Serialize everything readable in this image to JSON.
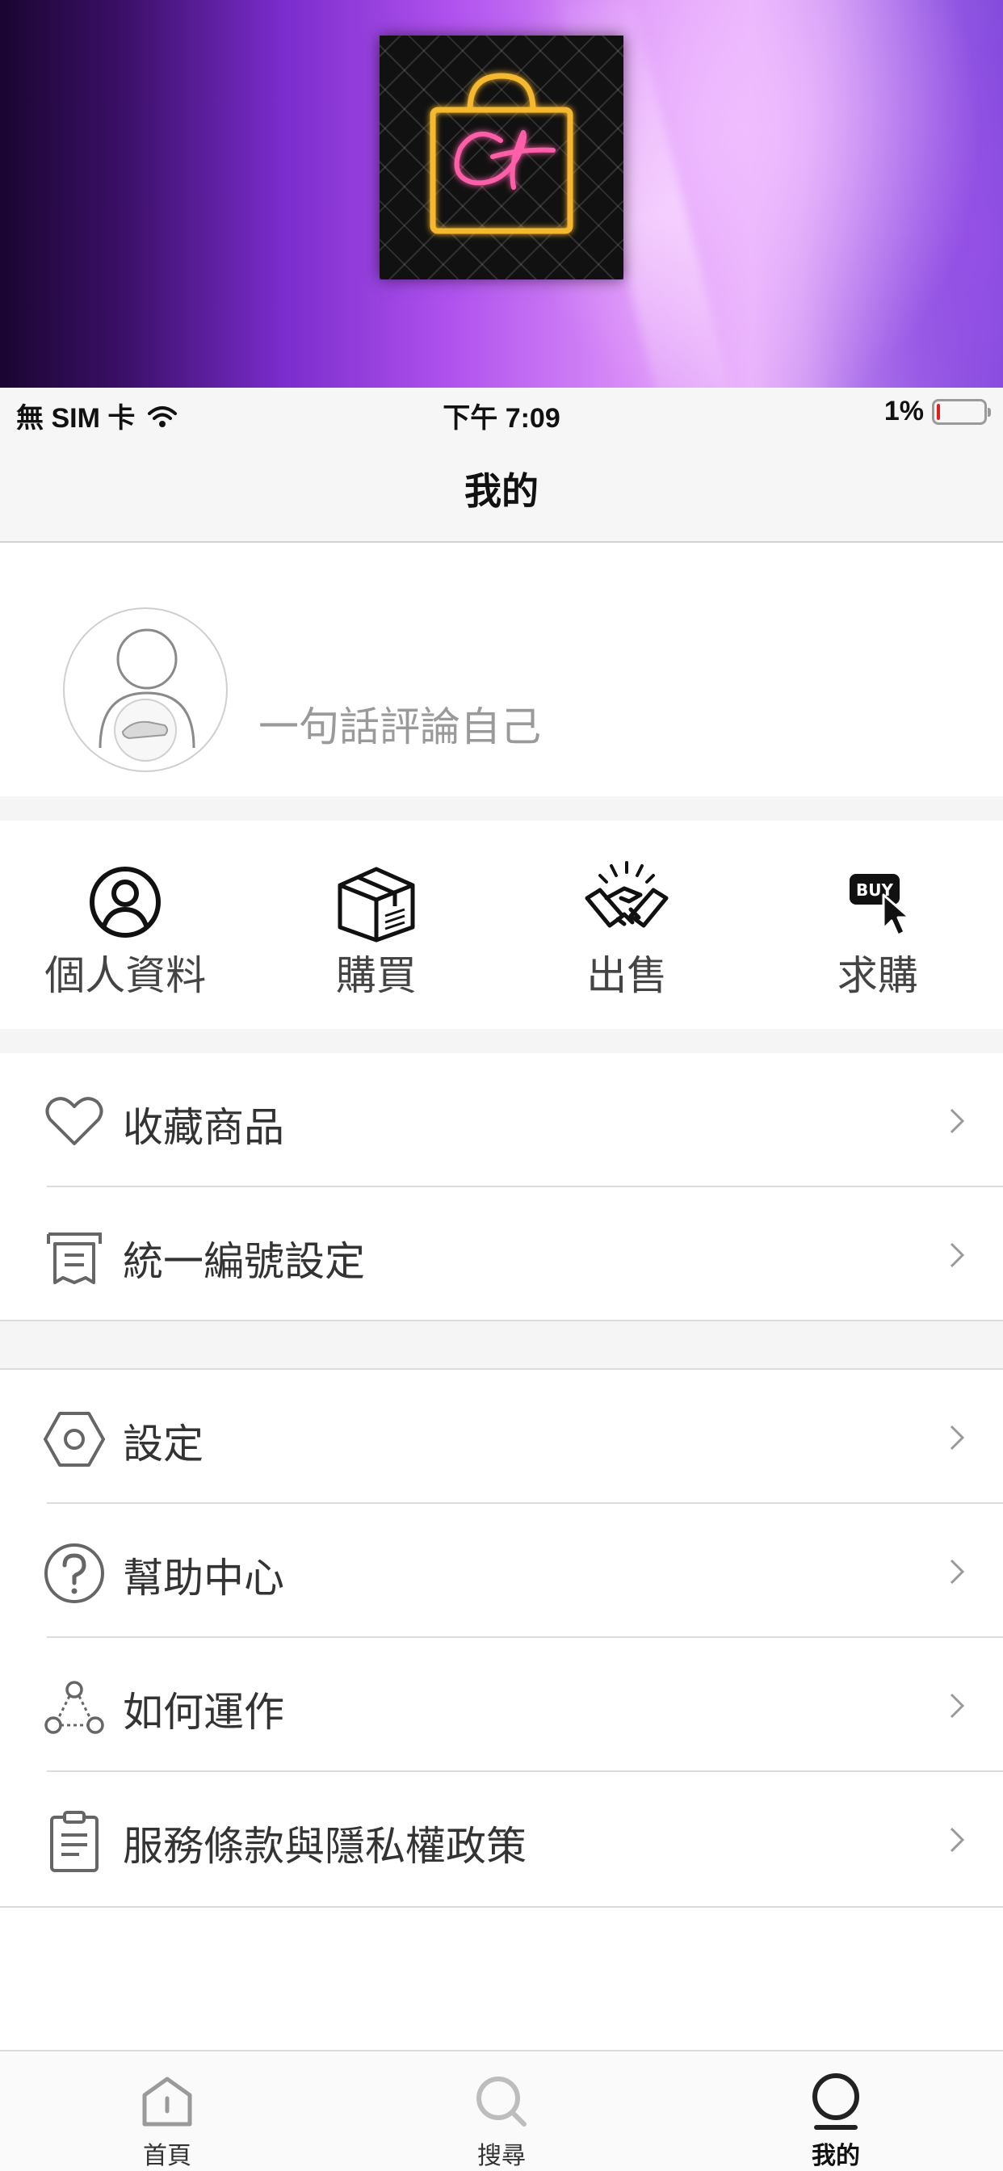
{
  "status_bar": {
    "carrier": "無 SIM 卡",
    "time": "下午 7:09",
    "battery": "1%"
  },
  "nav": {
    "title": "我的"
  },
  "profile": {
    "bio_placeholder": "一句話評論自己"
  },
  "actions": [
    {
      "label": "個人資料",
      "icon": "person-icon"
    },
    {
      "label": "購買",
      "icon": "package-icon"
    },
    {
      "label": "出售",
      "icon": "handshake-icon"
    },
    {
      "label": "求購",
      "icon": "buy-cursor-icon"
    }
  ],
  "menu_group_1": [
    {
      "label": "收藏商品",
      "icon": "heart-icon"
    },
    {
      "label": "統一編號設定",
      "icon": "receipt-icon"
    }
  ],
  "menu_group_2": [
    {
      "label": "設定",
      "icon": "hexagon-nut-icon"
    },
    {
      "label": "幫助中心",
      "icon": "help-icon"
    },
    {
      "label": "如何運作",
      "icon": "flow-nodes-icon"
    },
    {
      "label": "服務條款與隱私權政策",
      "icon": "clipboard-icon"
    }
  ],
  "tab_bar": {
    "items": [
      {
        "label": "首頁",
        "icon": "home-icon"
      },
      {
        "label": "搜尋",
        "icon": "search-icon"
      },
      {
        "label": "我的",
        "icon": "profile-tab-icon"
      }
    ],
    "active": "我的"
  },
  "colors": {
    "battery_low": "#e02020",
    "logo_neon_gold": "#f5b82e",
    "logo_neon_pink": "#ff5fa8"
  }
}
